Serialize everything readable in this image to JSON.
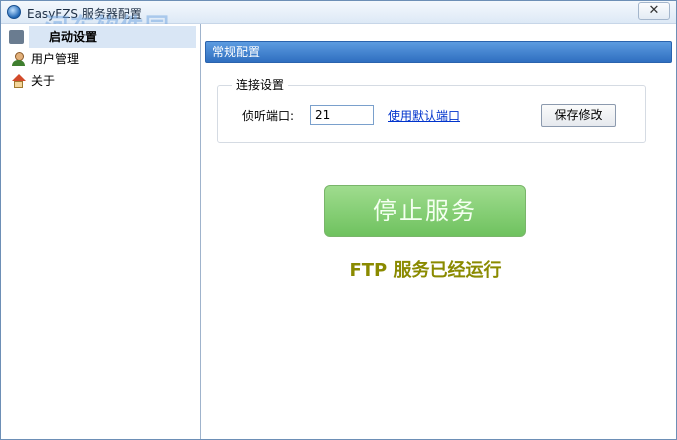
{
  "window": {
    "title": "EasyFZS 服务器配置",
    "close_glyph": "✕"
  },
  "watermark": {
    "text": "河东软件园",
    "url": "www.pc0359.cn"
  },
  "sidebar": {
    "items": [
      {
        "label": "启动设置",
        "icon": "start-icon",
        "selected": true
      },
      {
        "label": "用户管理",
        "icon": "user-icon",
        "selected": false
      },
      {
        "label": "关于",
        "icon": "about-icon",
        "selected": false
      }
    ]
  },
  "main": {
    "section_title": "常规配置",
    "connection": {
      "legend": "连接设置",
      "port_label": "侦听端口:",
      "port_value": "21",
      "default_link": "使用默认端口",
      "save_label": "保存修改"
    },
    "stop_label": "停止服务",
    "status": "FTP 服务已经运行"
  },
  "colors": {
    "header_blue": "#2f6fc0",
    "stop_green": "#6fc25f",
    "status_olive": "#8a8a00",
    "link_blue": "#0033cc"
  }
}
